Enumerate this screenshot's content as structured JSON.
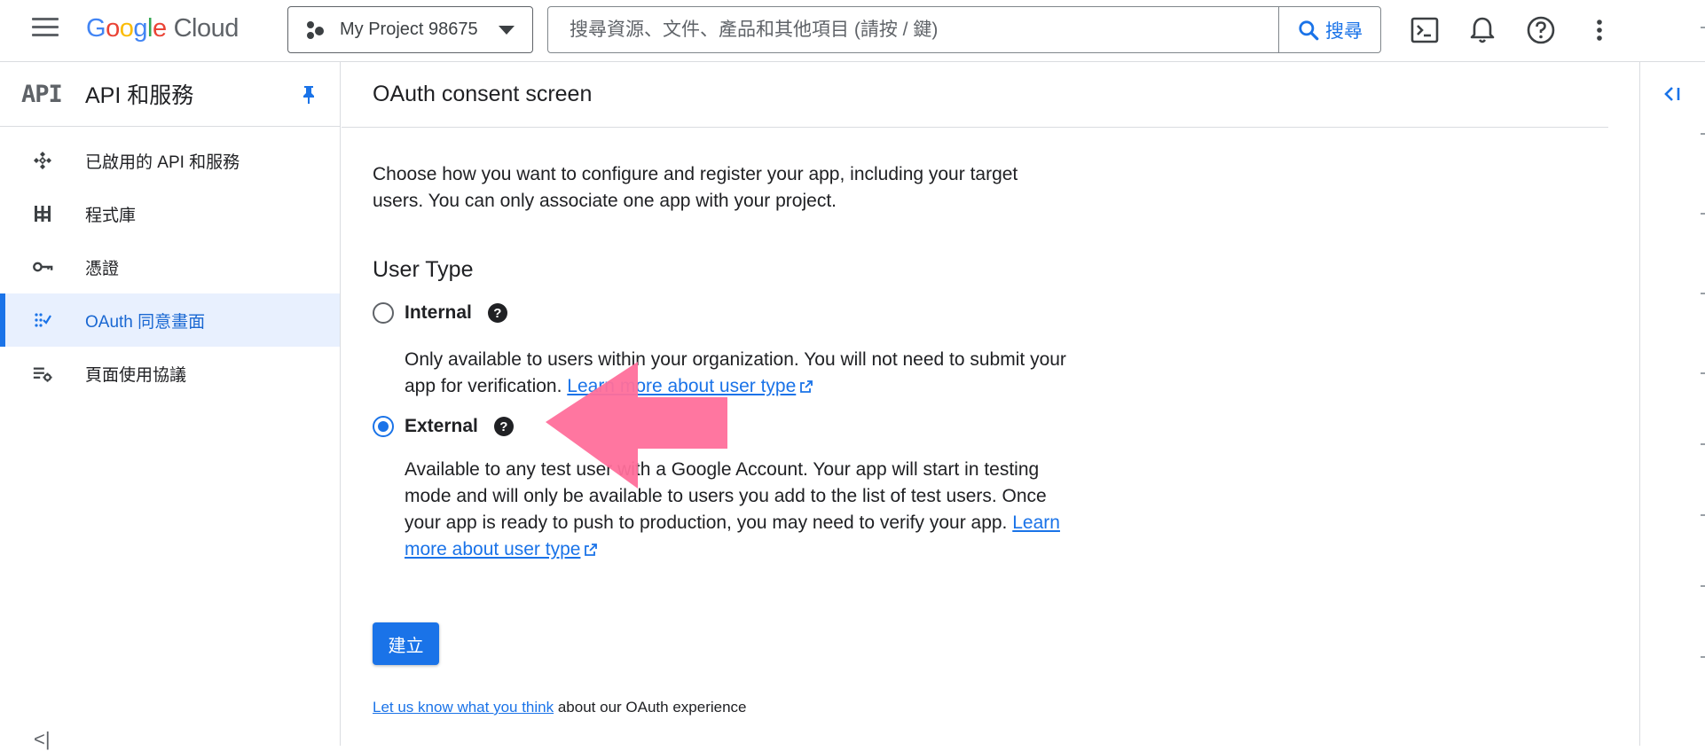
{
  "header": {
    "logo": {
      "g1": "G",
      "o1": "o",
      "o2": "o",
      "g2": "g",
      "l": "l",
      "e": "e",
      "product": "Cloud"
    },
    "project_name": "My Project 98675",
    "search_placeholder": "搜尋資源、文件、產品和其他項目 (請按 / 鍵)",
    "search_button_label": "搜尋",
    "icons": [
      "menu-icon",
      "project-icon",
      "chevron-down-icon",
      "search-icon",
      "cloud-shell-icon",
      "bell-icon",
      "help-icon",
      "more-vert-icon"
    ]
  },
  "sidebar": {
    "logo_text": "API",
    "title": "API 和服務",
    "items": [
      {
        "label": "已啟用的 API 和服務",
        "icon": "apis-icon",
        "active": false
      },
      {
        "label": "程式庫",
        "icon": "library-icon",
        "active": false
      },
      {
        "label": "憑證",
        "icon": "key-icon",
        "active": false
      },
      {
        "label": "OAuth 同意畫面",
        "icon": "oauth-icon",
        "active": true
      },
      {
        "label": "頁面使用協議",
        "icon": "page-settings-icon",
        "active": false
      }
    ]
  },
  "main": {
    "title": "OAuth consent screen",
    "intro": "Choose how you want to configure and register your app, including your target users. You can only associate one app with your project.",
    "user_type_title": "User Type",
    "options": {
      "internal": {
        "label": "Internal",
        "selected": false,
        "description": "Only available to users within your organization. You will not need to submit your app for verification.",
        "link": "Learn more about user type"
      },
      "external": {
        "label": "External",
        "selected": true,
        "description": "Available to any test user with a Google Account. Your app will start in testing mode and will only be available to users you add to the list of test users. Once your app is ready to push to production, you may need to verify your app.",
        "link": "Learn more about user type"
      }
    },
    "help_glyph": "?",
    "create_button": "建立",
    "feedback_link": "Let us know what you think",
    "feedback_text": " about our OAuth experience"
  },
  "colors": {
    "accent": "#1a73e8",
    "active_bg": "#e8f0fe",
    "annotation_arrow": "#ff6f9b"
  }
}
